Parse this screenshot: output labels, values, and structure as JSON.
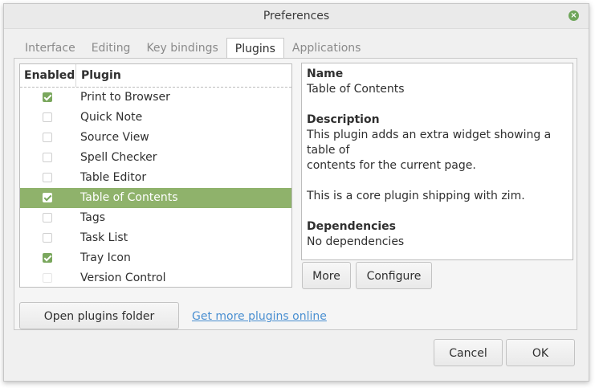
{
  "window": {
    "title": "Preferences"
  },
  "tabs": [
    {
      "label": "Interface",
      "active": false
    },
    {
      "label": "Editing",
      "active": false
    },
    {
      "label": "Key bindings",
      "active": false
    },
    {
      "label": "Plugins",
      "active": true
    },
    {
      "label": "Applications",
      "active": false
    }
  ],
  "plugin_list": {
    "headers": {
      "enabled": "Enabled",
      "plugin": "Plugin"
    },
    "rows": [
      {
        "label": "Print to Browser",
        "checked": true,
        "selected": false
      },
      {
        "label": "Quick Note",
        "checked": false,
        "selected": false
      },
      {
        "label": "Source View",
        "checked": false,
        "selected": false
      },
      {
        "label": "Spell Checker",
        "checked": false,
        "selected": false
      },
      {
        "label": "Table Editor",
        "checked": false,
        "selected": false
      },
      {
        "label": "Table of Contents",
        "checked": true,
        "selected": true
      },
      {
        "label": "Tags",
        "checked": false,
        "selected": false
      },
      {
        "label": "Task List",
        "checked": false,
        "selected": false
      },
      {
        "label": "Tray Icon",
        "checked": true,
        "selected": false
      },
      {
        "label": "Version Control",
        "checked": false,
        "selected": false
      }
    ]
  },
  "details": {
    "name_heading": "Name",
    "name_value": "Table of Contents",
    "description_heading": "Description",
    "description_line1": "This plugin adds an extra widget showing a",
    "description_line2": "table of",
    "description_line3": "contents for the current page.",
    "description_line4": "This is a core plugin shipping with zim.",
    "dependencies_heading": "Dependencies",
    "dependencies_value": "No dependencies"
  },
  "buttons": {
    "more": "More",
    "configure": "Configure",
    "open_folder": "Open plugins folder",
    "get_more_link": "Get more plugins online",
    "cancel": "Cancel",
    "ok": "OK"
  },
  "colors": {
    "selection": "#8fb26b",
    "checkbox_checked": "#7aa75d",
    "link": "#4a8fd1"
  },
  "icons": {
    "close": "close-icon"
  }
}
